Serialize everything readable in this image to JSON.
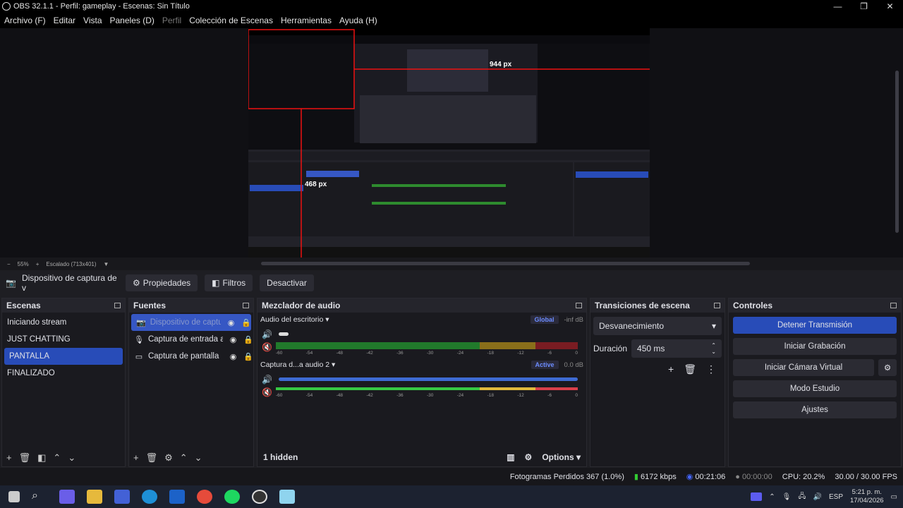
{
  "window": {
    "title": "OBS 32.1.1 - Perfil: gameplay - Escenas: Sin Título",
    "controls": [
      "—",
      "❐",
      "✕"
    ]
  },
  "menu": [
    "Archivo (F)",
    "Editar",
    "Vista",
    "Paneles (D)",
    "Perfil",
    "Colección de Escenas",
    "Herramientas",
    "Ayuda (H)"
  ],
  "preview": {
    "zoom": "55%",
    "scaling": "Escalado (713x401)",
    "overlay_w": "944 px",
    "overlay_h": "468 px"
  },
  "source_toolbar": {
    "source": "Dispositivo de captura de v",
    "properties": "Propiedades",
    "filters": "Filtros",
    "deactivate": "Desactivar"
  },
  "scenes": {
    "title": "Escenas",
    "items": [
      "Iniciando stream",
      "JUST CHATTING",
      "PANTALLA",
      "FINALIZADO"
    ],
    "selected": 2
  },
  "sources": {
    "title": "Fuentes",
    "items": [
      {
        "label": "Dispositivo de captura",
        "icon": "camera-icon"
      },
      {
        "label": "Captura de entrada au",
        "icon": "mic-icon"
      },
      {
        "label": "Captura de pantalla",
        "icon": "monitor-icon"
      }
    ]
  },
  "mixer": {
    "title": "Mezclador de audio",
    "channels": [
      {
        "name": "Audio del escritorio",
        "badge": "Global",
        "db": "-inf dB",
        "level": 0.02
      },
      {
        "name": "Captura d...a audio 2",
        "badge": "Active",
        "db": "0.0 dB",
        "level": 1.0
      }
    ],
    "ticks": [
      "-60",
      "-54",
      "-48",
      "-42",
      "-36",
      "-30",
      "-24",
      "-18",
      "-12",
      "-6",
      "0"
    ],
    "hidden": "1 hidden",
    "options": "Options"
  },
  "transitions": {
    "title": "Transiciones de escena",
    "type": "Desvanecimiento",
    "duration_label": "Duración",
    "duration": "450 ms"
  },
  "controls": {
    "title": "Controles",
    "buttons": [
      "Detener Transmisión",
      "Iniciar Grabación",
      "Iniciar Cámara Virtual",
      "Modo Estudio",
      "Ajustes"
    ]
  },
  "status": {
    "dropped": "Fotogramas Perdidos 367 (1.0%)",
    "bitrate": "6172 kbps",
    "stream_time": "00:21:06",
    "rec_time": "00:00:00",
    "cpu": "CPU: 20.2%",
    "fps": "30.00 / 30.00 FPS"
  },
  "taskbar": {
    "lang": "ESP",
    "time": "5:21 p. m.",
    "date": "17/04/2026"
  }
}
